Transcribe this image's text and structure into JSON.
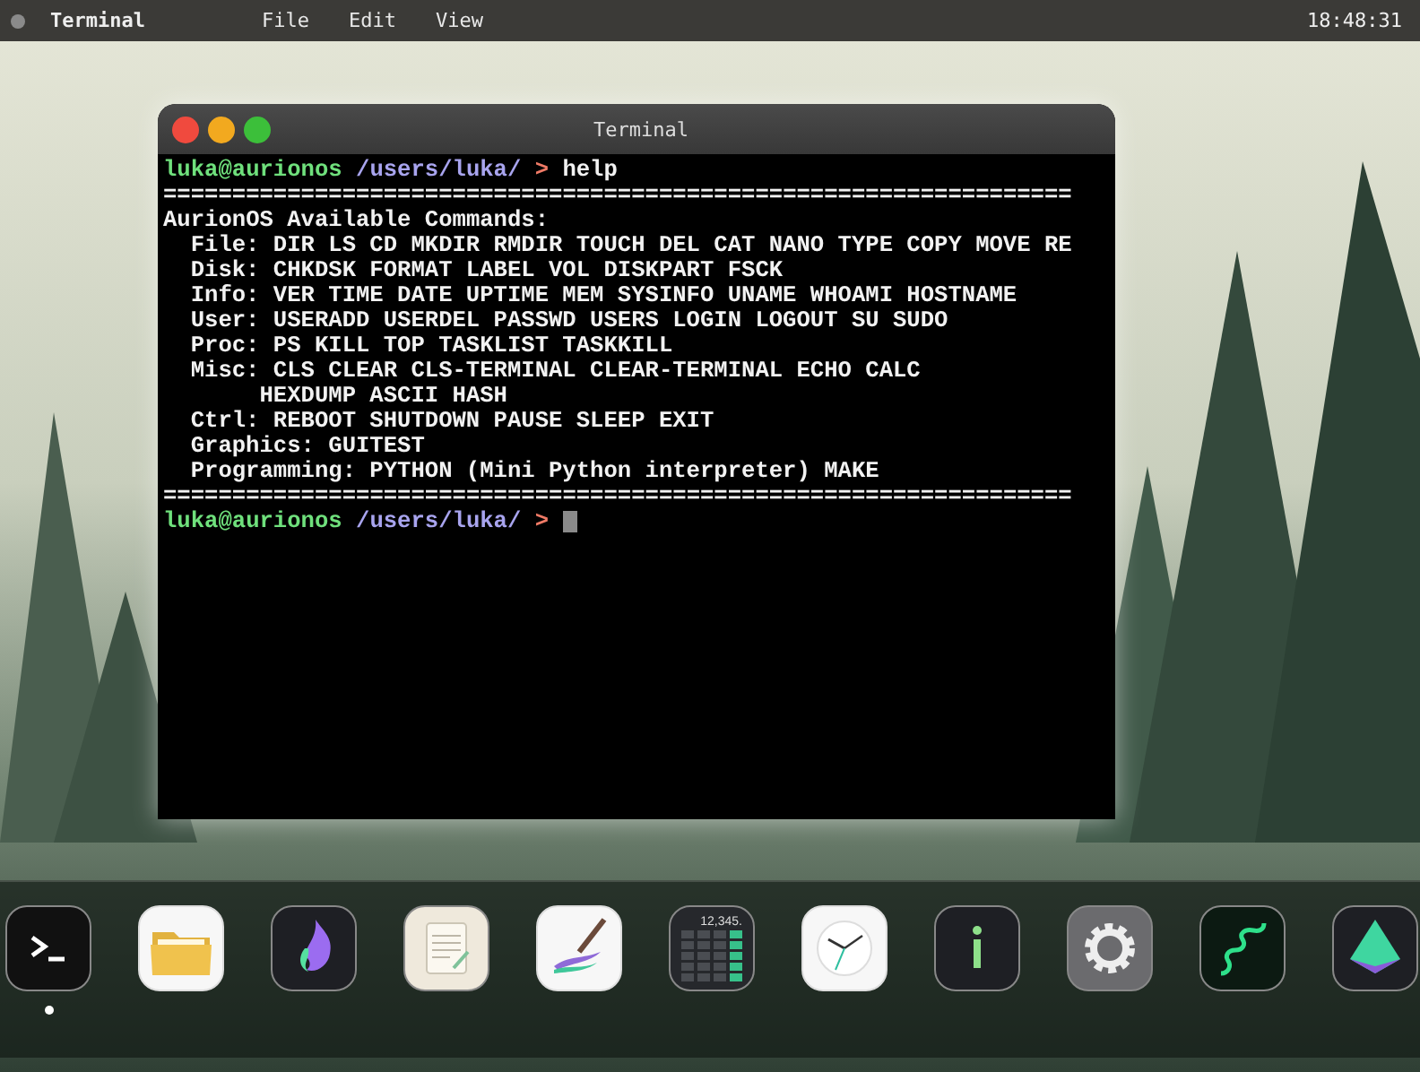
{
  "menu_bar": {
    "app_name": "Terminal",
    "menus": [
      "File",
      "Edit",
      "View"
    ],
    "clock": "18:48:31"
  },
  "window": {
    "title": "Terminal",
    "lines": [
      {
        "kind": "prompt",
        "user": "luka@aurionos",
        "path": "/users/luka/",
        "symbol": ">",
        "input": "help"
      },
      {
        "kind": "rule",
        "text": "=================================================================="
      },
      {
        "kind": "heading",
        "text": "AurionOS Available Commands:"
      },
      {
        "kind": "group",
        "text": "File: DIR LS CD MKDIR RMDIR TOUCH DEL CAT NANO TYPE COPY MOVE RE"
      },
      {
        "kind": "group",
        "text": "Disk: CHKDSK FORMAT LABEL VOL DISKPART FSCK"
      },
      {
        "kind": "group",
        "text": "Info: VER TIME DATE UPTIME MEM SYSINFO UNAME WHOAMI HOSTNAME"
      },
      {
        "kind": "group",
        "text": "User: USERADD USERDEL PASSWD USERS LOGIN LOGOUT SU SUDO"
      },
      {
        "kind": "group",
        "text": "Proc: PS KILL TOP TASKLIST TASKKILL"
      },
      {
        "kind": "group",
        "text": "Misc: CLS CLEAR CLS-TERMINAL CLEAR-TERMINAL ECHO CALC"
      },
      {
        "kind": "continuation",
        "text": "HEXDUMP ASCII HASH"
      },
      {
        "kind": "group",
        "text": "Ctrl: REBOOT SHUTDOWN PAUSE SLEEP EXIT"
      },
      {
        "kind": "group",
        "text": "Graphics: GUITEST"
      },
      {
        "kind": "group",
        "text": "Programming: PYTHON (Mini Python interpreter) MAKE"
      },
      {
        "kind": "rule",
        "text": "=================================================================="
      },
      {
        "kind": "prompt",
        "user": "luka@aurionos",
        "path": "/users/luka/",
        "symbol": ">",
        "cursor": true
      }
    ]
  },
  "dock": [
    {
      "kind": "terminal",
      "running": true
    },
    {
      "kind": "folder",
      "running": false
    },
    {
      "kind": "flame",
      "running": false
    },
    {
      "kind": "notepad",
      "running": false
    },
    {
      "kind": "paintbrush",
      "running": false
    },
    {
      "kind": "calculator",
      "display": "12,345.",
      "running": false
    },
    {
      "kind": "clock",
      "running": false
    },
    {
      "kind": "info",
      "running": false
    },
    {
      "kind": "settings",
      "running": false
    },
    {
      "kind": "snake",
      "running": false
    },
    {
      "kind": "pyramid",
      "running": false
    }
  ]
}
